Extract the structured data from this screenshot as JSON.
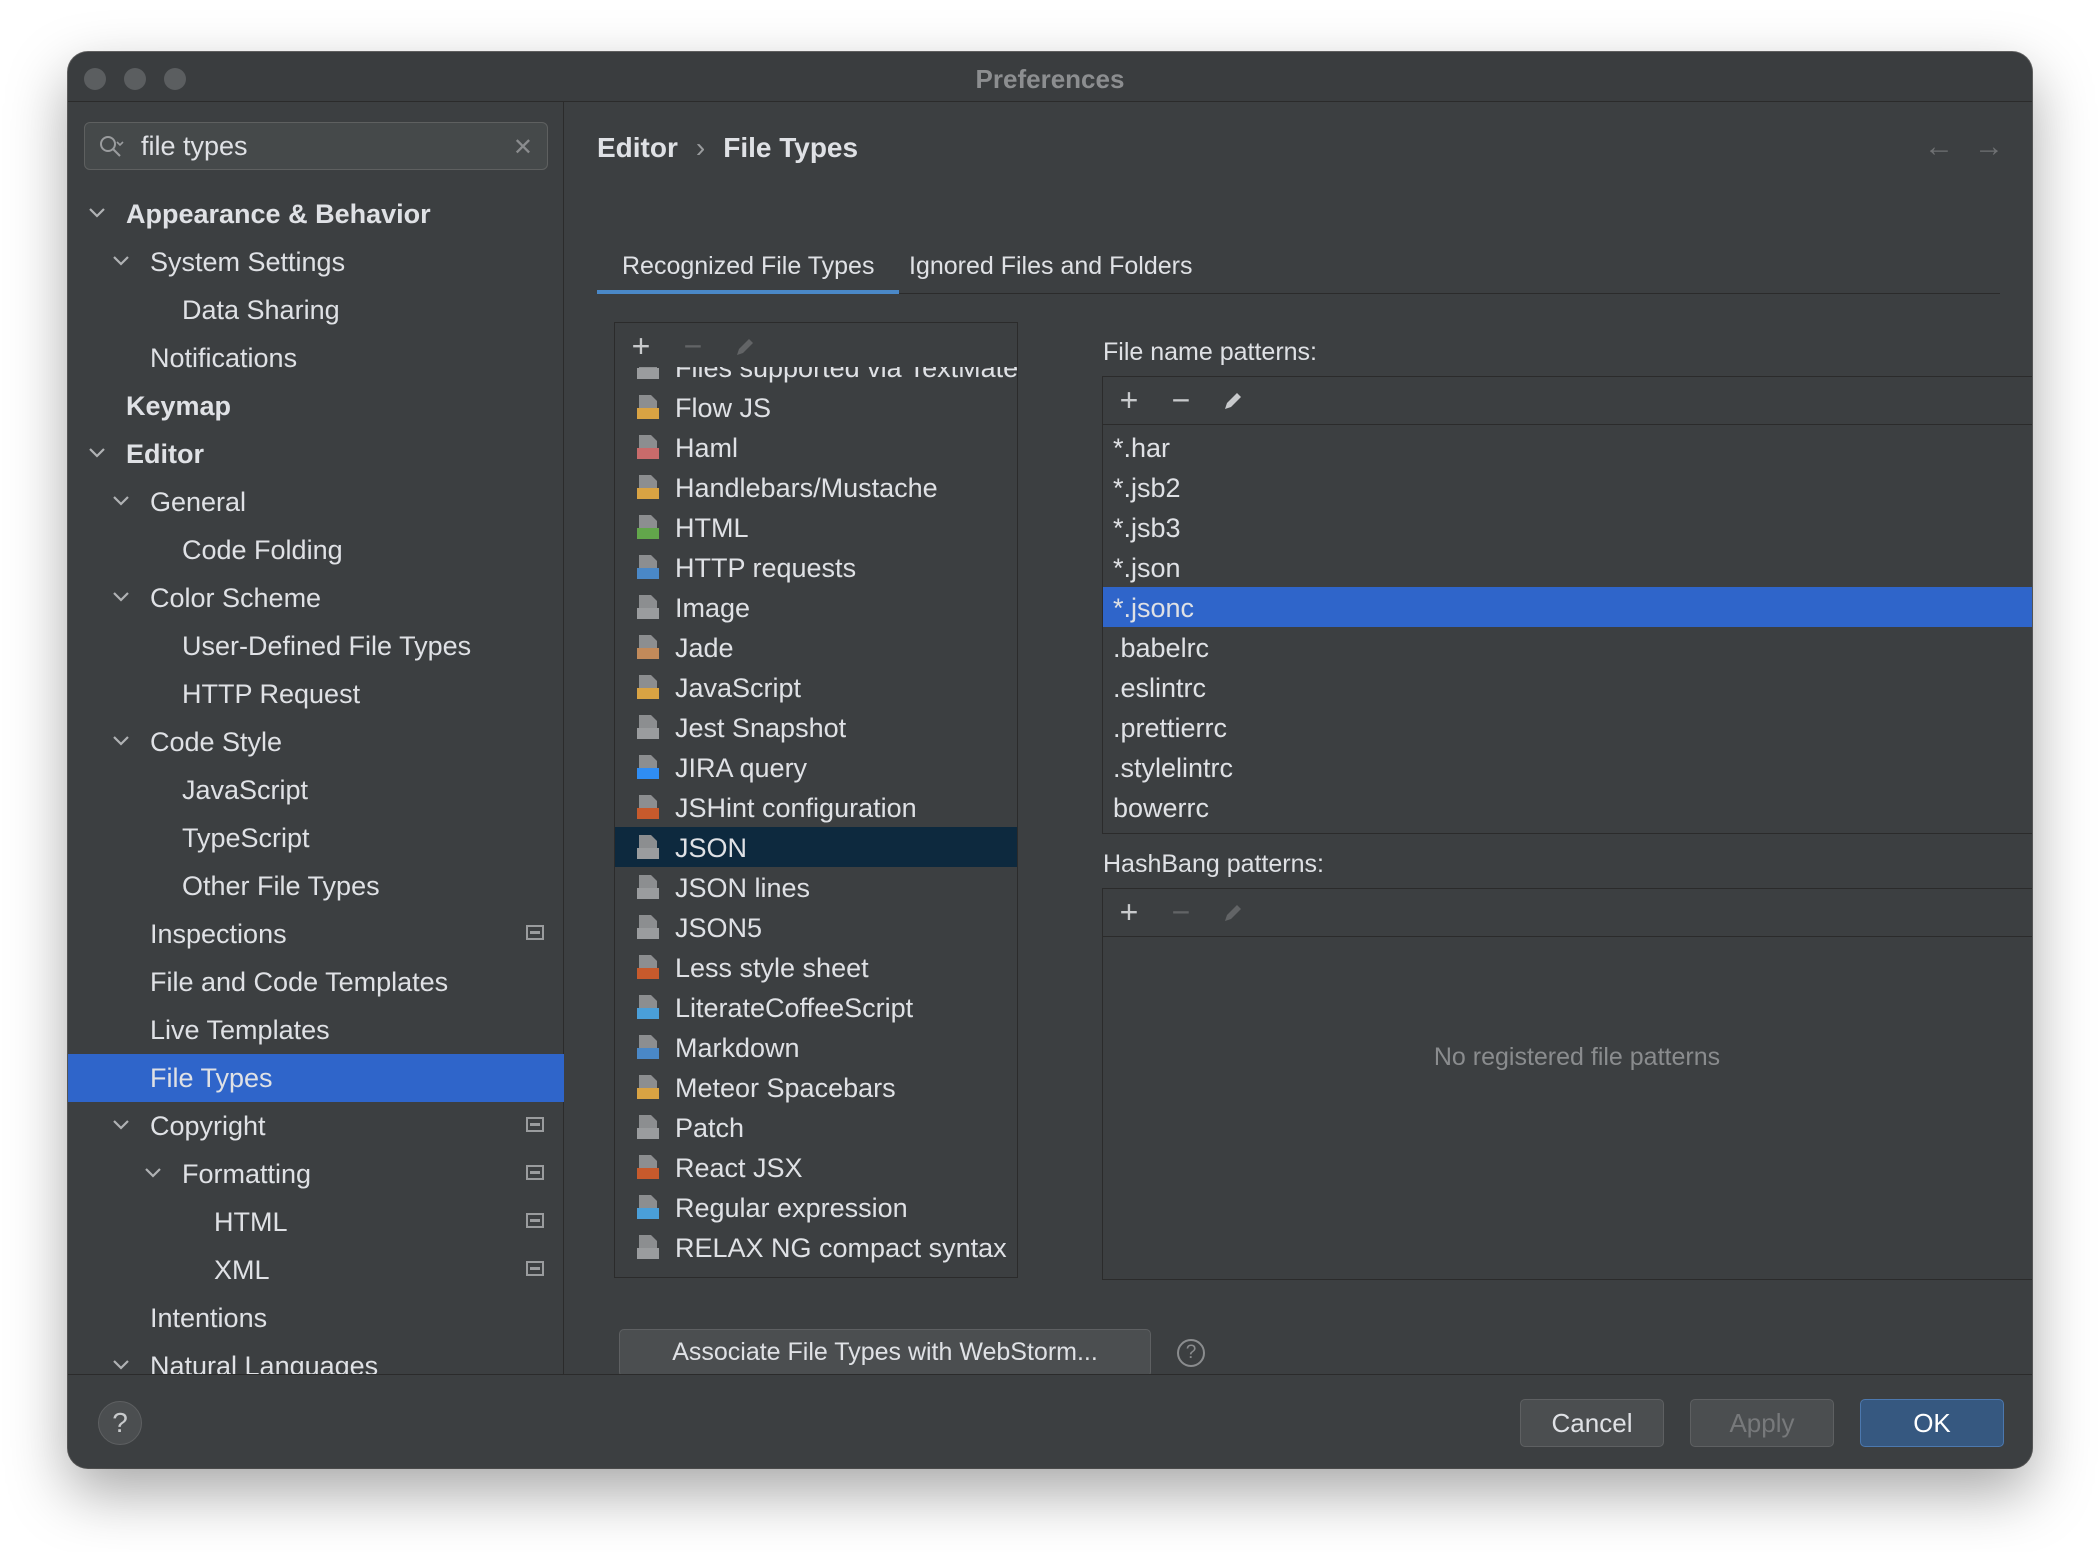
{
  "window": {
    "title": "Preferences"
  },
  "search": {
    "value": "file types",
    "clear_icon": "close-icon",
    "icon": "search-icon"
  },
  "sidebar": {
    "items": [
      {
        "label": "Appearance & Behavior",
        "bold": true,
        "expanded": true,
        "level": 0
      },
      {
        "label": "System Settings",
        "bold": false,
        "expanded": true,
        "level": 1
      },
      {
        "label": "Data Sharing",
        "bold": false,
        "level": 2
      },
      {
        "label": "Notifications",
        "bold": false,
        "level": 1
      },
      {
        "label": "Keymap",
        "bold": true,
        "level": 0
      },
      {
        "label": "Editor",
        "bold": true,
        "expanded": true,
        "level": 0
      },
      {
        "label": "General",
        "bold": false,
        "expanded": true,
        "level": 1
      },
      {
        "label": "Code Folding",
        "bold": false,
        "level": 2
      },
      {
        "label": "Color Scheme",
        "bold": false,
        "expanded": true,
        "level": 1
      },
      {
        "label": "User-Defined File Types",
        "bold": false,
        "level": 2
      },
      {
        "label": "HTTP Request",
        "bold": false,
        "level": 2
      },
      {
        "label": "Code Style",
        "bold": false,
        "expanded": true,
        "level": 1
      },
      {
        "label": "JavaScript",
        "bold": false,
        "level": 2
      },
      {
        "label": "TypeScript",
        "bold": false,
        "level": 2
      },
      {
        "label": "Other File Types",
        "bold": false,
        "level": 2
      },
      {
        "label": "Inspections",
        "bold": false,
        "level": 1,
        "project_icon": true
      },
      {
        "label": "File and Code Templates",
        "bold": false,
        "level": 1
      },
      {
        "label": "Live Templates",
        "bold": false,
        "level": 1
      },
      {
        "label": "File Types",
        "bold": false,
        "level": 1,
        "selected": true
      },
      {
        "label": "Copyright",
        "bold": false,
        "expanded": true,
        "level": 1,
        "project_icon": true
      },
      {
        "label": "Formatting",
        "bold": false,
        "expanded": true,
        "level": 2,
        "project_icon": true
      },
      {
        "label": "HTML",
        "bold": false,
        "level": 3,
        "project_icon": true
      },
      {
        "label": "XML",
        "bold": false,
        "level": 3,
        "project_icon": true
      },
      {
        "label": "Intentions",
        "bold": false,
        "level": 1
      },
      {
        "label": "Natural Languages",
        "bold": false,
        "expanded": true,
        "level": 1
      }
    ]
  },
  "breadcrumb": {
    "parent": "Editor",
    "separator": "›",
    "current": "File Types",
    "back_icon": "arrow-left-icon",
    "forward_icon": "arrow-right-icon"
  },
  "tabs": [
    {
      "label": "Recognized File Types",
      "active": true
    },
    {
      "label": "Ignored Files and Folders",
      "active": false
    }
  ],
  "file_types": {
    "toolbar": {
      "add": "+",
      "remove": "−"
    },
    "items": [
      {
        "label": "Files supported via TextMate bundles",
        "icon": "textmate-icon",
        "color": "#9a9c9e"
      },
      {
        "label": "Flow JS",
        "icon": "js-file-icon",
        "color": "#d9a343"
      },
      {
        "label": "Haml",
        "icon": "haml-file-icon",
        "color": "#c96b6b"
      },
      {
        "label": "Handlebars/Mustache",
        "icon": "handlebars-file-icon",
        "color": "#d9a343"
      },
      {
        "label": "HTML",
        "icon": "html-file-icon",
        "color": "#62a64b"
      },
      {
        "label": "HTTP requests",
        "icon": "api-file-icon",
        "color": "#4a88c7"
      },
      {
        "label": "Image",
        "icon": "image-file-icon",
        "color": "#9a9c9e"
      },
      {
        "label": "Jade",
        "icon": "jade-file-icon",
        "color": "#c28a5a"
      },
      {
        "label": "JavaScript",
        "icon": "js-file-icon",
        "color": "#d9a343"
      },
      {
        "label": "Jest Snapshot",
        "icon": "snapshot-file-icon",
        "color": "#9a9c9e"
      },
      {
        "label": "JIRA query",
        "icon": "jira-icon",
        "color": "#2f8df4"
      },
      {
        "label": "JSHint configuration",
        "icon": "jshint-icon",
        "color": "#c75a2c"
      },
      {
        "label": "JSON",
        "icon": "json-file-icon",
        "color": "#9a9c9e",
        "selected": true
      },
      {
        "label": "JSON lines",
        "icon": "json-file-icon",
        "color": "#9a9c9e"
      },
      {
        "label": "JSON5",
        "icon": "json-file-icon",
        "color": "#9a9c9e"
      },
      {
        "label": "Less style sheet",
        "icon": "less-file-icon",
        "color": "#c75a2c"
      },
      {
        "label": "LiterateCoffeeScript",
        "icon": "coffee-file-icon",
        "color": "#4a9fd9"
      },
      {
        "label": "Markdown",
        "icon": "markdown-file-icon",
        "color": "#4a88c7"
      },
      {
        "label": "Meteor Spacebars",
        "icon": "spacebars-file-icon",
        "color": "#d9a343"
      },
      {
        "label": "Patch",
        "icon": "patch-file-icon",
        "color": "#9a9c9e"
      },
      {
        "label": "React JSX",
        "icon": "jsx-file-icon",
        "color": "#c75a2c"
      },
      {
        "label": "Regular expression",
        "icon": "regex-file-icon",
        "color": "#4a9fd9"
      },
      {
        "label": "RELAX NG compact syntax",
        "icon": "text-file-icon",
        "color": "#9a9c9e"
      }
    ]
  },
  "file_name_patterns": {
    "label": "File name patterns:",
    "items": [
      "*.har",
      "*.jsb2",
      "*.jsb3",
      "*.json",
      "*.jsonc",
      ".babelrc",
      ".eslintrc",
      ".prettierrc",
      ".stylelintrc",
      "bowerrc"
    ],
    "selected_index": 4
  },
  "hashbang_patterns": {
    "label": "HashBang patterns:",
    "empty_text": "No registered file patterns"
  },
  "associate_button": {
    "label": "Associate File Types with WebStorm..."
  },
  "footer": {
    "help": "?",
    "cancel": "Cancel",
    "apply": "Apply",
    "ok": "OK"
  },
  "colors": {
    "selection": "#2f65ca",
    "list_selection": "#0d293e",
    "tab_accent": "#4a88c7",
    "background": "#3c3f41"
  }
}
